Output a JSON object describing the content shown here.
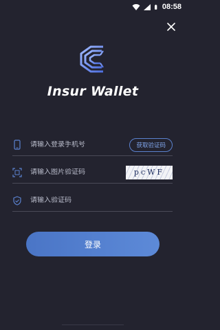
{
  "status_bar": {
    "time": "08:58",
    "icons": [
      "wifi-icon",
      "signal-icon",
      "battery-icon"
    ]
  },
  "header": {
    "close_icon": "close-icon"
  },
  "brand": {
    "logo_icon": "insur-wallet-logo-icon",
    "app_name": "Insur Wallet"
  },
  "form": {
    "phone": {
      "icon": "phone-icon",
      "placeholder": "请输入登录手机号",
      "value": "",
      "get_code_label": "获取验证码"
    },
    "captcha": {
      "icon": "image-captcha-icon",
      "placeholder": "请输入图片验证码",
      "value": "",
      "captcha_text": "pcWF"
    },
    "code": {
      "icon": "shield-check-icon",
      "placeholder": "请输入验证码",
      "value": ""
    },
    "login_label": "登录"
  },
  "colors": {
    "background": "#23232f",
    "accent": "#4f7dcf",
    "divider": "#4a4a58"
  }
}
